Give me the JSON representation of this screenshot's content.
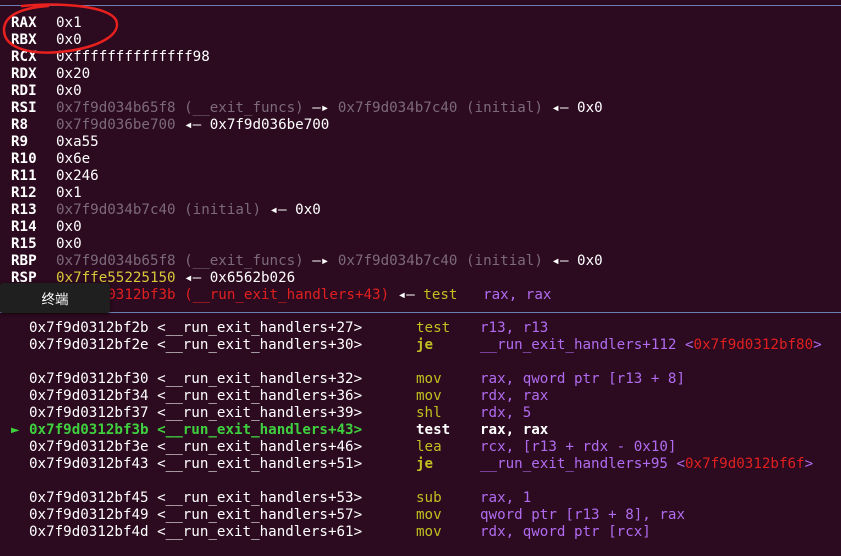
{
  "registers": [
    {
      "name": "RAX",
      "parts": [
        {
          "t": "0x1",
          "c": "white"
        }
      ]
    },
    {
      "name": "RBX",
      "parts": [
        {
          "t": "0x0",
          "c": "white"
        }
      ]
    },
    {
      "name": "RCX",
      "parts": [
        {
          "t": "0xffffffffffffff98",
          "c": "white"
        }
      ]
    },
    {
      "name": "RDX",
      "parts": [
        {
          "t": "0x20",
          "c": "white"
        }
      ]
    },
    {
      "name": "RDI",
      "parts": [
        {
          "t": "0x0",
          "c": "white"
        }
      ]
    },
    {
      "name": "RSI",
      "parts": [
        {
          "t": "0x7f9d034b65f8 (__exit_funcs) ",
          "c": "gray"
        },
        {
          "t": "—▸ ",
          "c": "white"
        },
        {
          "t": "0x7f9d034b7c40 (initial) ",
          "c": "gray"
        },
        {
          "t": "◂— 0x0",
          "c": "white"
        }
      ]
    },
    {
      "name": "R8",
      "parts": [
        {
          "t": "0x7f9d036be700 ",
          "c": "gray"
        },
        {
          "t": "◂— 0x7f9d036be700",
          "c": "white"
        }
      ]
    },
    {
      "name": "R9",
      "parts": [
        {
          "t": "0xa55",
          "c": "white"
        }
      ]
    },
    {
      "name": "R10",
      "parts": [
        {
          "t": "0x6e",
          "c": "white"
        }
      ]
    },
    {
      "name": "R11",
      "parts": [
        {
          "t": "0x246",
          "c": "white"
        }
      ]
    },
    {
      "name": "R12",
      "parts": [
        {
          "t": "0x1",
          "c": "white"
        }
      ]
    },
    {
      "name": "R13",
      "parts": [
        {
          "t": "0x7f9d034b7c40 (initial) ",
          "c": "gray"
        },
        {
          "t": "◂— 0x0",
          "c": "white"
        }
      ]
    },
    {
      "name": "R14",
      "parts": [
        {
          "t": "0x0",
          "c": "white"
        }
      ]
    },
    {
      "name": "R15",
      "parts": [
        {
          "t": "0x0",
          "c": "white"
        }
      ]
    },
    {
      "name": "RBP",
      "parts": [
        {
          "t": "0x7f9d034b65f8 (__exit_funcs) ",
          "c": "gray"
        },
        {
          "t": "—▸ ",
          "c": "white"
        },
        {
          "t": "0x7f9d034b7c40 (initial) ",
          "c": "gray"
        },
        {
          "t": "◂— 0x0",
          "c": "white"
        }
      ]
    },
    {
      "name": "RSP",
      "parts": [
        {
          "t": "0x7ffe55225150 ",
          "c": "yellow"
        },
        {
          "t": "◂— 0x6562b026",
          "c": "white"
        }
      ]
    },
    {
      "name": "RIP",
      "parts": [
        {
          "t": "0x7f9d0312bf3b (__run_exit_handlers+43) ",
          "c": "red"
        },
        {
          "t": "◂— ",
          "c": "white"
        },
        {
          "t": "test   ",
          "c": "olive"
        },
        {
          "t": "rax, rax",
          "c": "purple"
        }
      ]
    }
  ],
  "disasm": [
    {
      "addr": "0x7f9d0312bf2b <__run_exit_handlers+27>",
      "mnem": "test",
      "mnem_bold": false,
      "ops": [
        {
          "t": "r13, r13",
          "c": "purple"
        }
      ]
    },
    {
      "addr": "0x7f9d0312bf2e <__run_exit_handlers+30>",
      "mnem": "je",
      "mnem_bold": true,
      "ops": [
        {
          "t": "__run_exit_handlers+112 <",
          "c": "purple"
        },
        {
          "t": "0x7f9d0312bf80",
          "c": "red"
        },
        {
          "t": ">",
          "c": "purple"
        }
      ]
    },
    {
      "gap": true
    },
    {
      "addr": "0x7f9d0312bf30 <__run_exit_handlers+32>",
      "mnem": "mov",
      "mnem_bold": false,
      "ops": [
        {
          "t": "rax, qword ptr [r13 + 8]",
          "c": "purple"
        }
      ]
    },
    {
      "addr": "0x7f9d0312bf34 <__run_exit_handlers+36>",
      "mnem": "mov",
      "mnem_bold": false,
      "ops": [
        {
          "t": "rdx, rax",
          "c": "purple"
        }
      ]
    },
    {
      "addr": "0x7f9d0312bf37 <__run_exit_handlers+39>",
      "mnem": "shl",
      "mnem_bold": false,
      "ops": [
        {
          "t": "rdx, 5",
          "c": "purple"
        }
      ]
    },
    {
      "addr": "0x7f9d0312bf3b <__run_exit_handlers+43>",
      "mnem": "test",
      "mnem_bold": true,
      "current": true,
      "ops": [
        {
          "t": "rax, rax",
          "c": "purple"
        }
      ]
    },
    {
      "addr": "0x7f9d0312bf3e <__run_exit_handlers+46>",
      "mnem": "lea",
      "mnem_bold": false,
      "ops": [
        {
          "t": "rcx, [r13 + rdx - 0x10]",
          "c": "purple"
        }
      ]
    },
    {
      "addr": "0x7f9d0312bf43 <__run_exit_handlers+51>",
      "mnem": "je",
      "mnem_bold": true,
      "ops": [
        {
          "t": "__run_exit_handlers+95 <",
          "c": "purple"
        },
        {
          "t": "0x7f9d0312bf6f",
          "c": "red"
        },
        {
          "t": ">",
          "c": "purple"
        }
      ]
    },
    {
      "gap": true
    },
    {
      "addr": "0x7f9d0312bf45 <__run_exit_handlers+53>",
      "mnem": "sub",
      "mnem_bold": false,
      "ops": [
        {
          "t": "rax, 1",
          "c": "purple"
        }
      ]
    },
    {
      "addr": "0x7f9d0312bf49 <__run_exit_handlers+57>",
      "mnem": "mov",
      "mnem_bold": false,
      "ops": [
        {
          "t": "qword ptr [r13 + 8], rax",
          "c": "purple"
        }
      ]
    },
    {
      "addr": "0x7f9d0312bf4d <__run_exit_handlers+61>",
      "mnem": "mov",
      "mnem_bold": false,
      "ops": [
        {
          "t": "rdx, qword ptr [rcx]",
          "c": "purple"
        }
      ]
    }
  ],
  "current_arrow": "►",
  "tooltip": {
    "label": "终端"
  },
  "colors": {
    "background": "#2c0a1f",
    "separator": "#6b7fb0",
    "annotation": "#e8201e"
  }
}
